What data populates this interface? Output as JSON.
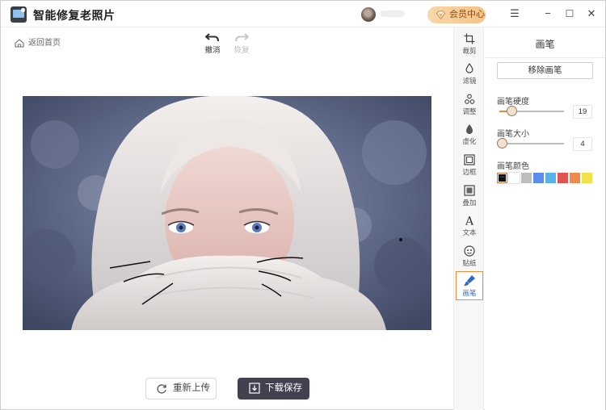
{
  "app": {
    "title": "智能修复老照片"
  },
  "header": {
    "vip_label": "会员中心",
    "minimize": "−",
    "maximize": "☐",
    "close": "✕",
    "menu": "☰"
  },
  "toolbar": {
    "back": "返回首页",
    "undo": "撤消",
    "redo": "恢复"
  },
  "actions": {
    "reupload": "重新上传",
    "download": "下载保存"
  },
  "rail": {
    "items": [
      {
        "label": "裁剪",
        "icon": "crop-icon"
      },
      {
        "label": "滤镜",
        "icon": "filter-icon"
      },
      {
        "label": "调整",
        "icon": "adjust-icon"
      },
      {
        "label": "虚化",
        "icon": "blur-icon"
      },
      {
        "label": "边框",
        "icon": "border-icon"
      },
      {
        "label": "叠加",
        "icon": "overlay-icon"
      },
      {
        "label": "文本",
        "icon": "text-icon"
      },
      {
        "label": "贴纸",
        "icon": "sticker-icon"
      },
      {
        "label": "画笔",
        "icon": "brush-icon",
        "active": true
      }
    ]
  },
  "panel": {
    "title": "画笔",
    "remove_label": "移除画笔",
    "hardness": {
      "label": "画笔硬度",
      "value": "19",
      "fraction": 0.19
    },
    "size": {
      "label": "画笔大小",
      "value": "4",
      "fraction": 0.04
    },
    "color_label": "画笔颜色",
    "swatch_selected_glyph": "···",
    "colors": [
      "#111111",
      "#ffffff",
      "#bdbdbd",
      "#5b8def",
      "#54b4ee",
      "#e05353",
      "#ee8b4a",
      "#f2e24a"
    ],
    "selected_color_index": 0
  },
  "colors": {
    "accent": "#e58a3d",
    "download_bg": "#434050",
    "active_rail": "#2e69c7"
  }
}
